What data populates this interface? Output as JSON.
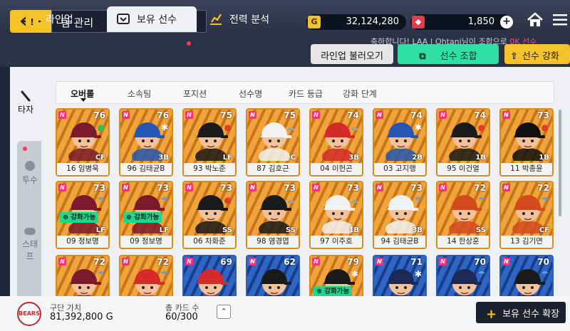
{
  "header": {
    "title": "팀 관리",
    "gold": "32,124,280",
    "gold_icon": "G",
    "gems": "1,850",
    "ticker_prefix": "축하합니다! LAA | Ohtani님이 조합으로 ",
    "ticker_highlight": "0K 선수"
  },
  "tabs": [
    {
      "label": "라인업",
      "active": false
    },
    {
      "label": "보유 선수",
      "active": true
    },
    {
      "label": "전력 분석",
      "active": false
    }
  ],
  "actions": {
    "load_lineup": "라인업 불러오기",
    "combine": "선수 조합",
    "upgrade": "선수 강화"
  },
  "side": {
    "batter": "타자",
    "pitcher": "투수",
    "staff": "스태프"
  },
  "filters": [
    "오버롤",
    "소속팀",
    "포지션",
    "선수명",
    "카드 등급",
    "강화 단계"
  ],
  "cards": [
    {
      "name": "16 임병욱",
      "rating": "76",
      "pos": "CF",
      "cond": "●",
      "cond_color": "#2ec24a",
      "theme": "orange",
      "helmet": "#7a1b2c",
      "upg": ""
    },
    {
      "name": "96 김태균B",
      "rating": "76",
      "pos": "3B",
      "cond": "✱",
      "cond_color": "#ffffff",
      "theme": "orange",
      "helmet": "#2457b3",
      "upg": ""
    },
    {
      "name": "93 박노준",
      "rating": "75",
      "pos": "LF",
      "cond": "●",
      "cond_color": "#e43b2a",
      "theme": "orange",
      "helmet": "#1a1a1a",
      "upg": ""
    },
    {
      "name": "87 김호근",
      "rating": "75",
      "pos": "C",
      "cond": "☁",
      "cond_color": "#9aa0ac",
      "theme": "orange",
      "helmet": "#f2f2f2",
      "upg": ""
    },
    {
      "name": "04 이헌곤",
      "rating": "74",
      "pos": "3B",
      "cond": "☁",
      "cond_color": "#9aa0ac",
      "theme": "orange",
      "helmet": "#d52b2b",
      "upg": ""
    },
    {
      "name": "03 고지행",
      "rating": "74",
      "pos": "2B",
      "cond": "✱",
      "cond_color": "#ffffff",
      "theme": "orange",
      "helmet": "#2457b3",
      "upg": ""
    },
    {
      "name": "95 이건열",
      "rating": "74",
      "pos": "1B",
      "cond": "●",
      "cond_color": "#e43b2a",
      "theme": "orange",
      "helmet": "#1a1a1a",
      "upg": ""
    },
    {
      "name": "11 박종윤",
      "rating": "73",
      "pos": "1B",
      "cond": "●",
      "cond_color": "#e43b2a",
      "theme": "orange",
      "helmet": "#111111",
      "upg": ""
    },
    {
      "name": "09 정보명",
      "rating": "73",
      "pos": "LF",
      "cond": "☂",
      "cond_color": "#5aa0e0",
      "theme": "orange",
      "helmet": "#7a1b2c",
      "upg": "강화가능"
    },
    {
      "name": "09 정보명",
      "rating": "73",
      "pos": "LF",
      "cond": "☂",
      "cond_color": "#5aa0e0",
      "theme": "orange",
      "helmet": "#7a1b2c",
      "upg": "강화가능"
    },
    {
      "name": "06 차화준",
      "rating": "73",
      "pos": "SS",
      "cond": "●",
      "cond_color": "#e43b2a",
      "theme": "orange",
      "helmet": "#1a1a1a",
      "upg": ""
    },
    {
      "name": "98 염경엽",
      "rating": "73",
      "pos": "SS",
      "cond": "☁",
      "cond_color": "#9aa0ac",
      "theme": "orange",
      "helmet": "#1a1a1a",
      "upg": ""
    },
    {
      "name": "97 이주호",
      "rating": "73",
      "pos": "1B",
      "cond": "☁",
      "cond_color": "#9aa0ac",
      "theme": "orange",
      "helmet": "#f2f2f2",
      "upg": ""
    },
    {
      "name": "94 김태균B",
      "rating": "73",
      "pos": "3B",
      "cond": "☂",
      "cond_color": "#5aa0e0",
      "theme": "orange",
      "helmet": "#f2f2f2",
      "upg": ""
    },
    {
      "name": "14 한상훈",
      "rating": "72",
      "pos": "SS",
      "cond": "☂",
      "cond_color": "#5aa0e0",
      "theme": "orange",
      "helmet": "#d24a1e",
      "upg": ""
    },
    {
      "name": "13 김기연",
      "rating": "72",
      "pos": "CF",
      "cond": "☂",
      "cond_color": "#5aa0e0",
      "theme": "orange",
      "helmet": "#d24a1e",
      "upg": ""
    },
    {
      "name": "",
      "rating": "72",
      "pos": "",
      "cond": "☂",
      "cond_color": "#5aa0e0",
      "theme": "orange",
      "helmet": "#7a1b2c",
      "upg": ""
    },
    {
      "name": "",
      "rating": "72",
      "pos": "",
      "cond": "☂",
      "cond_color": "#5aa0e0",
      "theme": "orange",
      "helmet": "#d52b2b",
      "upg": ""
    },
    {
      "name": "",
      "rating": "69",
      "pos": "",
      "cond": "",
      "cond_color": "#ffffff",
      "theme": "blue",
      "helmet": "#d52b2b",
      "upg": ""
    },
    {
      "name": "",
      "rating": "62",
      "pos": "",
      "cond": "",
      "cond_color": "#ffffff",
      "theme": "blue",
      "helmet": "#1a1a1a",
      "upg": ""
    },
    {
      "name": "",
      "rating": "79",
      "pos": "",
      "cond": "✱",
      "cond_color": "#ffffff",
      "theme": "orange",
      "helmet": "#1a1a1a",
      "upg": "강화가능"
    },
    {
      "name": "",
      "rating": "71",
      "pos": "",
      "cond": "✱",
      "cond_color": "#ffffff",
      "theme": "blue",
      "helmet": "#1a2a55",
      "upg": ""
    },
    {
      "name": "",
      "rating": "70",
      "pos": "",
      "cond": "☂",
      "cond_color": "#5aa0e0",
      "theme": "blue",
      "helmet": "#1a2a55",
      "upg": ""
    },
    {
      "name": "",
      "rating": "70",
      "pos": "",
      "cond": "☂",
      "cond_color": "#5aa0e0",
      "theme": "blue",
      "helmet": "#1a1a1a",
      "upg": ""
    }
  ],
  "footer": {
    "team_logo": "BEARS",
    "value_label": "구단 가치",
    "value": "81,392,800 G",
    "count_label": "총 카드 수",
    "count": "60/300",
    "expand": "보유 선수 확장"
  }
}
